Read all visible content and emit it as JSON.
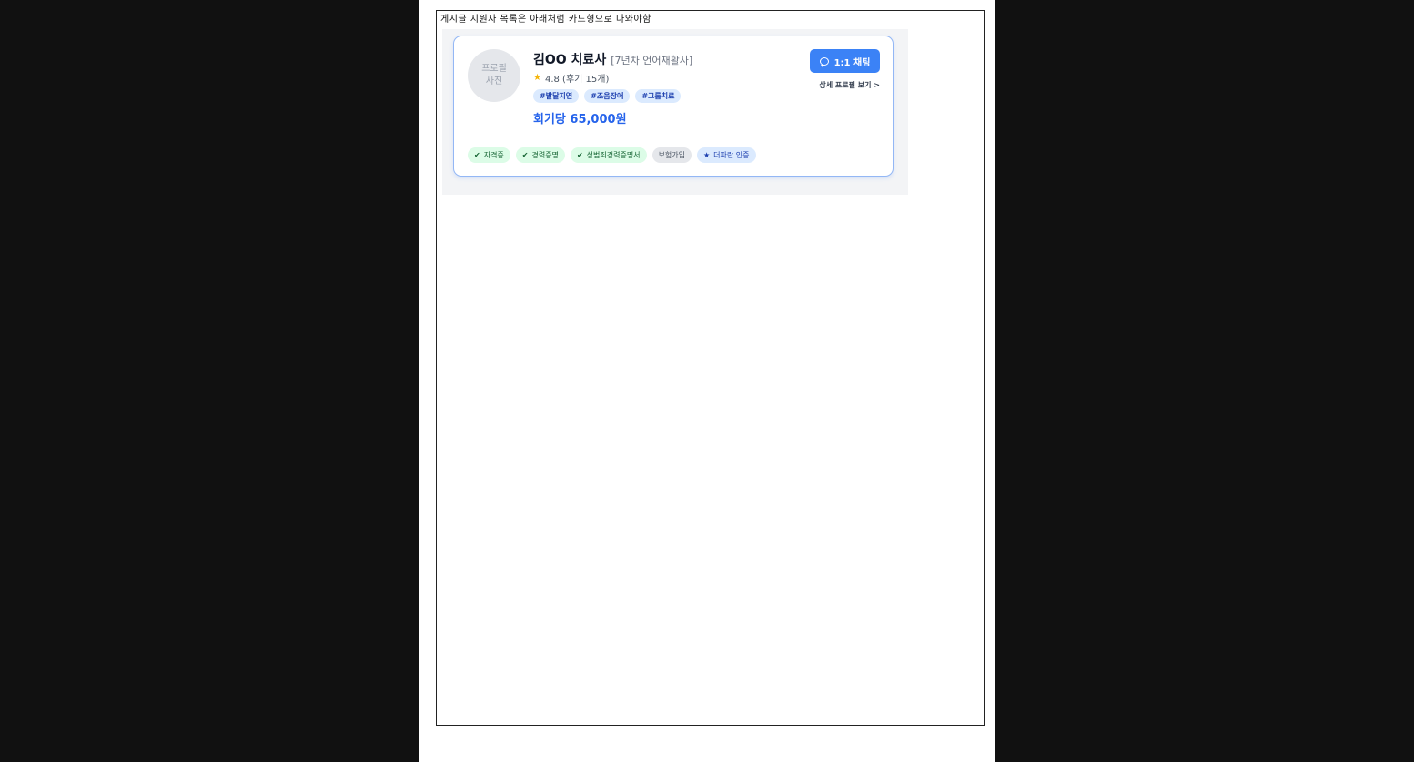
{
  "note": "게시글 지원자 목록은 아래처럼 카드형으로 나와야함",
  "card": {
    "avatar_placeholder": "프로필\n사진",
    "name": "김OO 치료사",
    "subtitle": "[7년차 언어재활사]",
    "rating": {
      "star_icon": "★",
      "text": "4.8 (후기 15개)"
    },
    "tags": [
      "#발달지연",
      "#조음장애",
      "#그룹치료"
    ],
    "price": "회기당 65,000원",
    "chat_button": {
      "icon": "chat-bubble-icon",
      "label": "1:1 채팅"
    },
    "profile_link": "상세 프로필 보기 >",
    "badges": [
      {
        "icon": "✔",
        "label": "자격증",
        "style": "green"
      },
      {
        "icon": "✔",
        "label": "경력증명",
        "style": "green"
      },
      {
        "icon": "✔",
        "label": "성범죄경력증명서",
        "style": "green"
      },
      {
        "icon": "",
        "label": "보험가입",
        "style": "gray"
      },
      {
        "icon": "★",
        "label": "더파란 인증",
        "style": "blue"
      }
    ]
  },
  "colors": {
    "accent": "#3b82f6",
    "price": "#2563eb",
    "card_border": "#93b7f5",
    "star": "#f5b50a"
  }
}
